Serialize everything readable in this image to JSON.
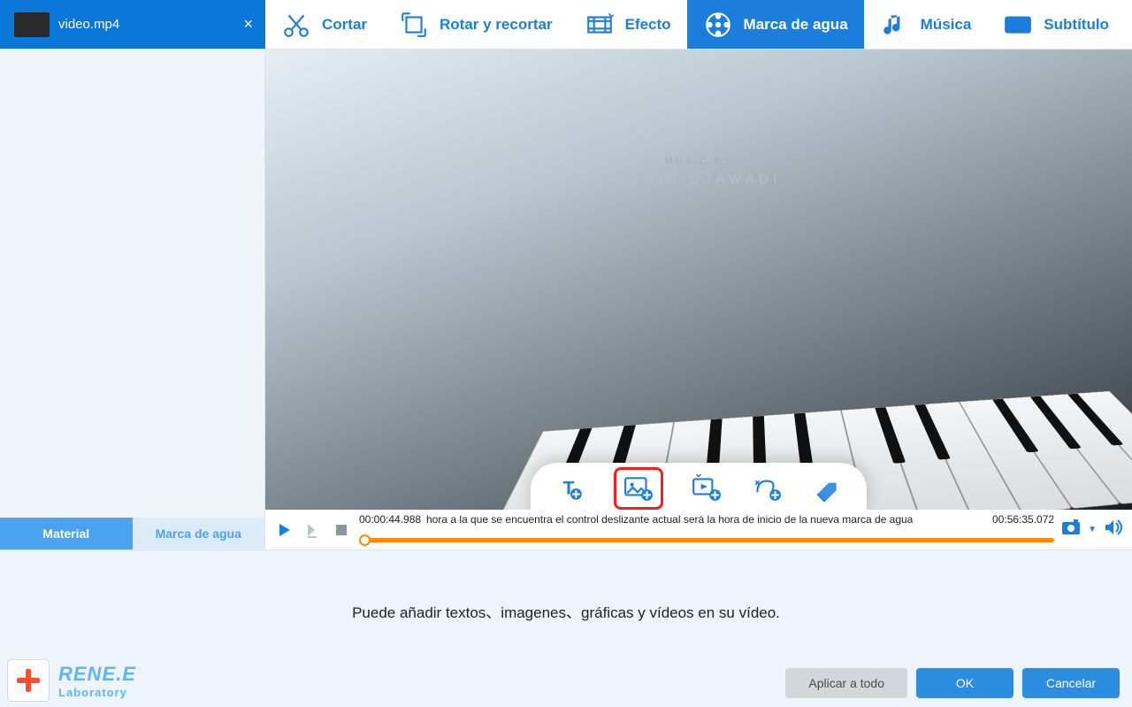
{
  "file": {
    "name": "video.mp4"
  },
  "tools": {
    "cut": "Cortar",
    "rotate": "Rotar y recortar",
    "effect": "Efecto",
    "watermark": "Marca de agua",
    "music": "Música",
    "subtitle": "Subtítulo"
  },
  "left_tabs": {
    "material": "Material",
    "watermark": "Marca de agua"
  },
  "preview": {
    "credit_label": "MUSIC BY",
    "credit_name": "RAMIN DJAWADI"
  },
  "timeline": {
    "current": "00:00:44.988",
    "hint": "hora a la que se encuentra el control deslizante actual será la hora de inicio de la nueva marca de agua",
    "total": "00:56:35.072"
  },
  "bottom": {
    "hint": "Puede añadir textos、imagenes、gráficas y vídeos en su vídeo."
  },
  "brand": {
    "line1": "RENE.E",
    "line2": "Laboratory"
  },
  "buttons": {
    "apply_all": "Aplicar a todo",
    "ok": "OK",
    "cancel": "Cancelar"
  }
}
